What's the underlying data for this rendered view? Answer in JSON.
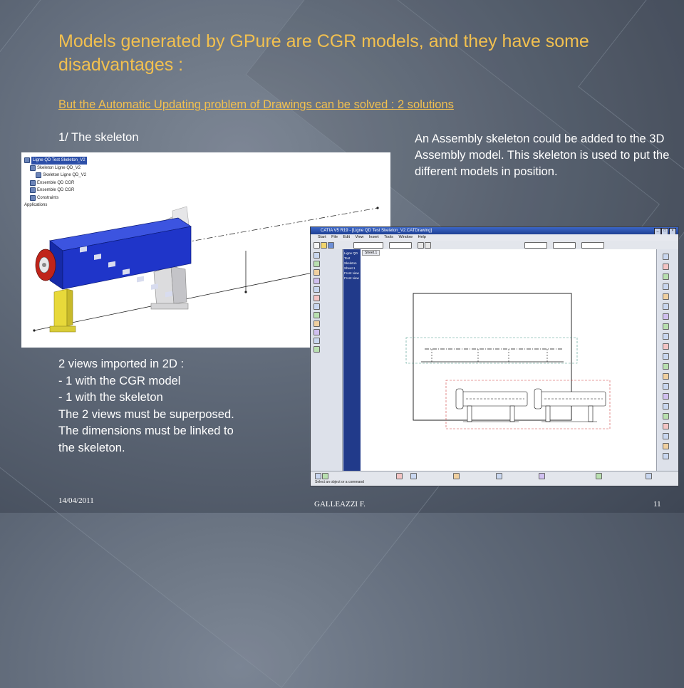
{
  "slide": {
    "title": "Models generated by GPure are CGR models, and they have some disadvantages :",
    "subtitle": "But the Automatic Updating problem of Drawings  can be solved : 2 solutions",
    "heading": "1/ The skeleton",
    "assembly_description": "An Assembly skeleton could be added to the 3D Assembly model. This skeleton is used to put the different models in position.",
    "views_description": [
      "2 views imported in 2D :",
      "- 1 with the CGR model",
      "- 1 with the skeleton",
      "The 2 views must be superposed.",
      "The dimensions must be linked to",
      "the skeleton."
    ]
  },
  "model_tree": {
    "items": [
      "Ligne QD Test Skeleton_V2",
      "Skeleton Ligne QD_V2",
      "Skeleton Ligne QD_V2",
      "Ensemble QD CGR",
      "Ensemble QD CGR",
      "Constraints",
      "Applications"
    ]
  },
  "catia": {
    "title": "CATIA V5 R19 - [Ligne QD Test Skeleton_V2.CATDrawing]",
    "menu": "Start File Edit View Insert Tools Window Help",
    "sheet_tab": "Sheet.1",
    "tree_items": [
      "Ligne QD Test Skeleton",
      "Sheet.1",
      "Front view",
      "Front view"
    ],
    "status": "Select an object or a command"
  },
  "footer": {
    "date": "14/04/2011",
    "author": "GALLEAZZI F.",
    "page": "11"
  },
  "colors": {
    "title": "#f2c04f",
    "text": "#ffffff",
    "model_body": "#1f35c9",
    "model_leg": "#e8d93a",
    "model_end": "#c0241a"
  }
}
